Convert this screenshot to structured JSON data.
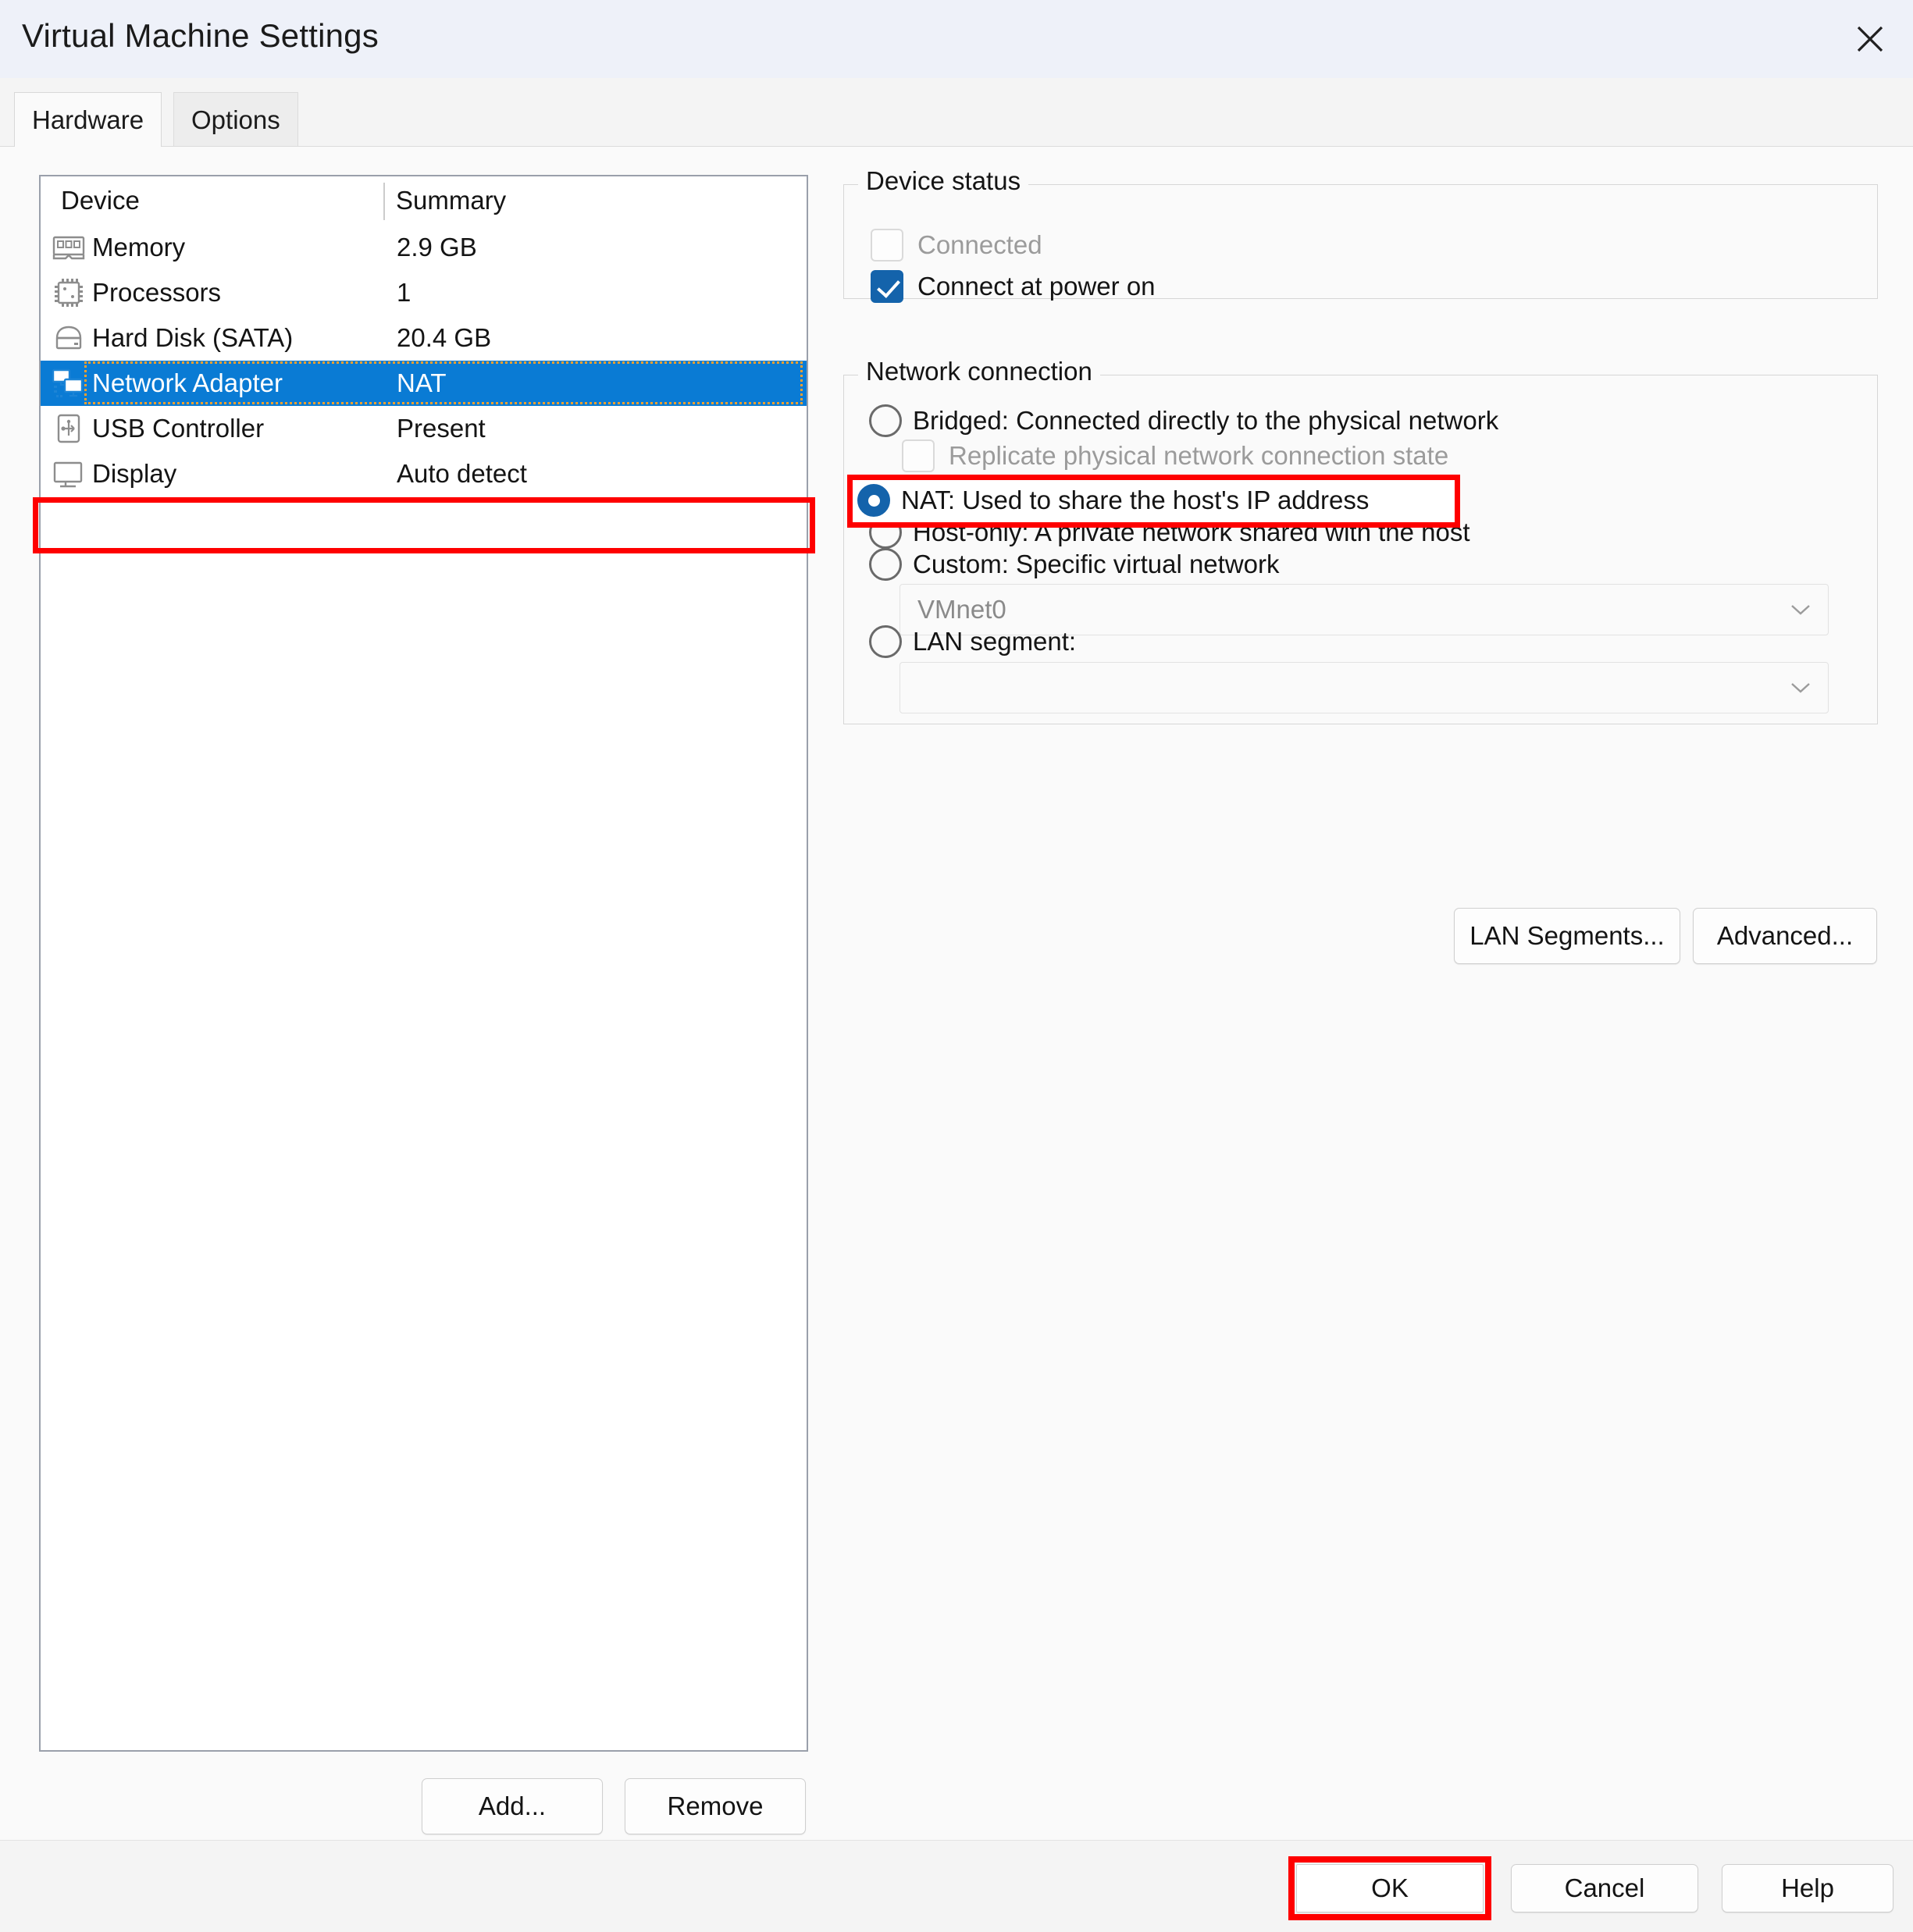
{
  "window": {
    "title": "Virtual Machine Settings",
    "close_icon": "close-icon"
  },
  "tabs": [
    {
      "label": "Hardware",
      "active": true
    },
    {
      "label": "Options",
      "active": false
    }
  ],
  "device_list": {
    "columns": {
      "device": "Device",
      "summary": "Summary"
    },
    "rows": [
      {
        "icon": "memory-icon",
        "name": "Memory",
        "summary": "2.9 GB",
        "selected": false
      },
      {
        "icon": "processor-icon",
        "name": "Processors",
        "summary": "1",
        "selected": false
      },
      {
        "icon": "hard-disk-icon",
        "name": "Hard Disk (SATA)",
        "summary": "20.4 GB",
        "selected": false
      },
      {
        "icon": "network-adapter-icon",
        "name": "Network Adapter",
        "summary": "NAT",
        "selected": true
      },
      {
        "icon": "usb-controller-icon",
        "name": "USB Controller",
        "summary": "Present",
        "selected": false
      },
      {
        "icon": "display-icon",
        "name": "Display",
        "summary": "Auto detect",
        "selected": false
      }
    ],
    "add_label": "Add...",
    "remove_label": "Remove"
  },
  "device_status": {
    "legend": "Device status",
    "connected": {
      "label": "Connected",
      "checked": false,
      "disabled": true
    },
    "connect_at_power_on": {
      "label": "Connect at power on",
      "checked": true,
      "disabled": false
    }
  },
  "network_connection": {
    "legend": "Network connection",
    "options": [
      {
        "label": "Bridged: Connected directly to the physical network",
        "selected": false
      },
      {
        "label": "NAT: Used to share the host's IP address",
        "selected": true
      },
      {
        "label": "Host-only: A private network shared with the host",
        "selected": false
      },
      {
        "label": "Custom: Specific virtual network",
        "selected": false
      },
      {
        "label": "LAN segment:",
        "selected": false
      }
    ],
    "replicate": {
      "label": "Replicate physical network connection state",
      "checked": false,
      "disabled": true
    },
    "custom_network_value": "VMnet0",
    "lan_segment_value": "",
    "lan_segments_button": "LAN Segments...",
    "advanced_button": "Advanced..."
  },
  "footer": {
    "ok": "OK",
    "cancel": "Cancel",
    "help": "Help"
  },
  "annotations": {
    "highlight_color": "#fe0000",
    "targets": [
      "network-adapter-row",
      "nat-radio-option",
      "ok-button"
    ]
  },
  "colors": {
    "selection_blue": "#0a7bd4",
    "accent_blue": "#1463ab",
    "focus_orange": "#f0a030",
    "titlebar": "#eef1f9",
    "body": "#fafafa"
  }
}
